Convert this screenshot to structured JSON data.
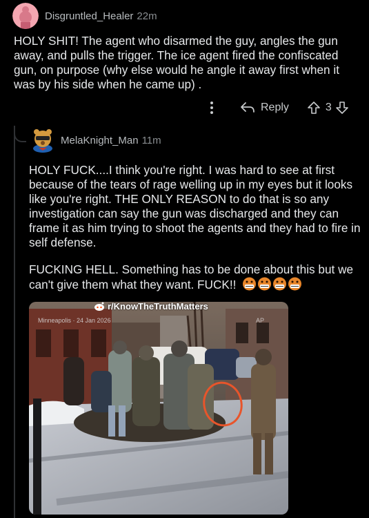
{
  "parent_comment": {
    "username": "Disgruntled_Healer",
    "time": "22m",
    "body": "HOLY SHIT! The agent who disarmed the guy, angles the gun away, and pulls the trigger. The ice agent fired the confiscated gun, on purpose (why else would he angle it away first when it was by his side when he came up) .",
    "actions": {
      "reply_label": "Reply",
      "vote_count": "3"
    }
  },
  "reply_comment": {
    "username": "MelaKnight_Man",
    "time": "11m",
    "paragraph_1": "HOLY FUCK....I think you're right. I was hard to see at first because of the tears of rage welling up in my eyes but it looks like you're right. THE ONLY REASON to do that is so any investigation can say the gun was discharged and they can frame it as him trying to shoot the agents and they had to fire in self defense.",
    "paragraph_2": "FUCKING HELL. Something has to be done about this but we can't give them what they want. FUCK!!",
    "emoji_count": 4
  },
  "media": {
    "watermark": "r/KnowTheTruthMatters",
    "video_caption": "Minneapolis · 24 Jan 2026",
    "video_corner": "AP"
  },
  "colors": {
    "background": "#000000",
    "text": "#e6e8ea",
    "muted": "#8a8e91",
    "annotation_circle": "#e8552b"
  }
}
